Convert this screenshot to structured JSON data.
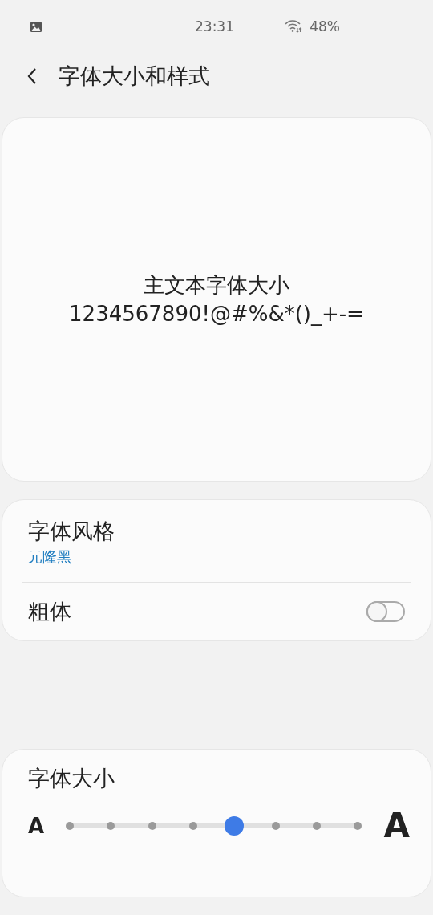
{
  "status_bar": {
    "time": "23:31",
    "battery": "48%"
  },
  "header": {
    "title": "字体大小和样式"
  },
  "preview": {
    "lines": [
      "主文本字体大小",
      "1234567890!@#%&*()_+-="
    ]
  },
  "style_card": {
    "items": [
      {
        "kind": "value",
        "title": "字体风格",
        "value": "元隆黑"
      },
      {
        "kind": "switch",
        "title": "粗体",
        "on": false
      }
    ]
  },
  "size_card": {
    "title": "字体大小",
    "small_label": "A",
    "large_label": "A",
    "level": 0.5714
  }
}
